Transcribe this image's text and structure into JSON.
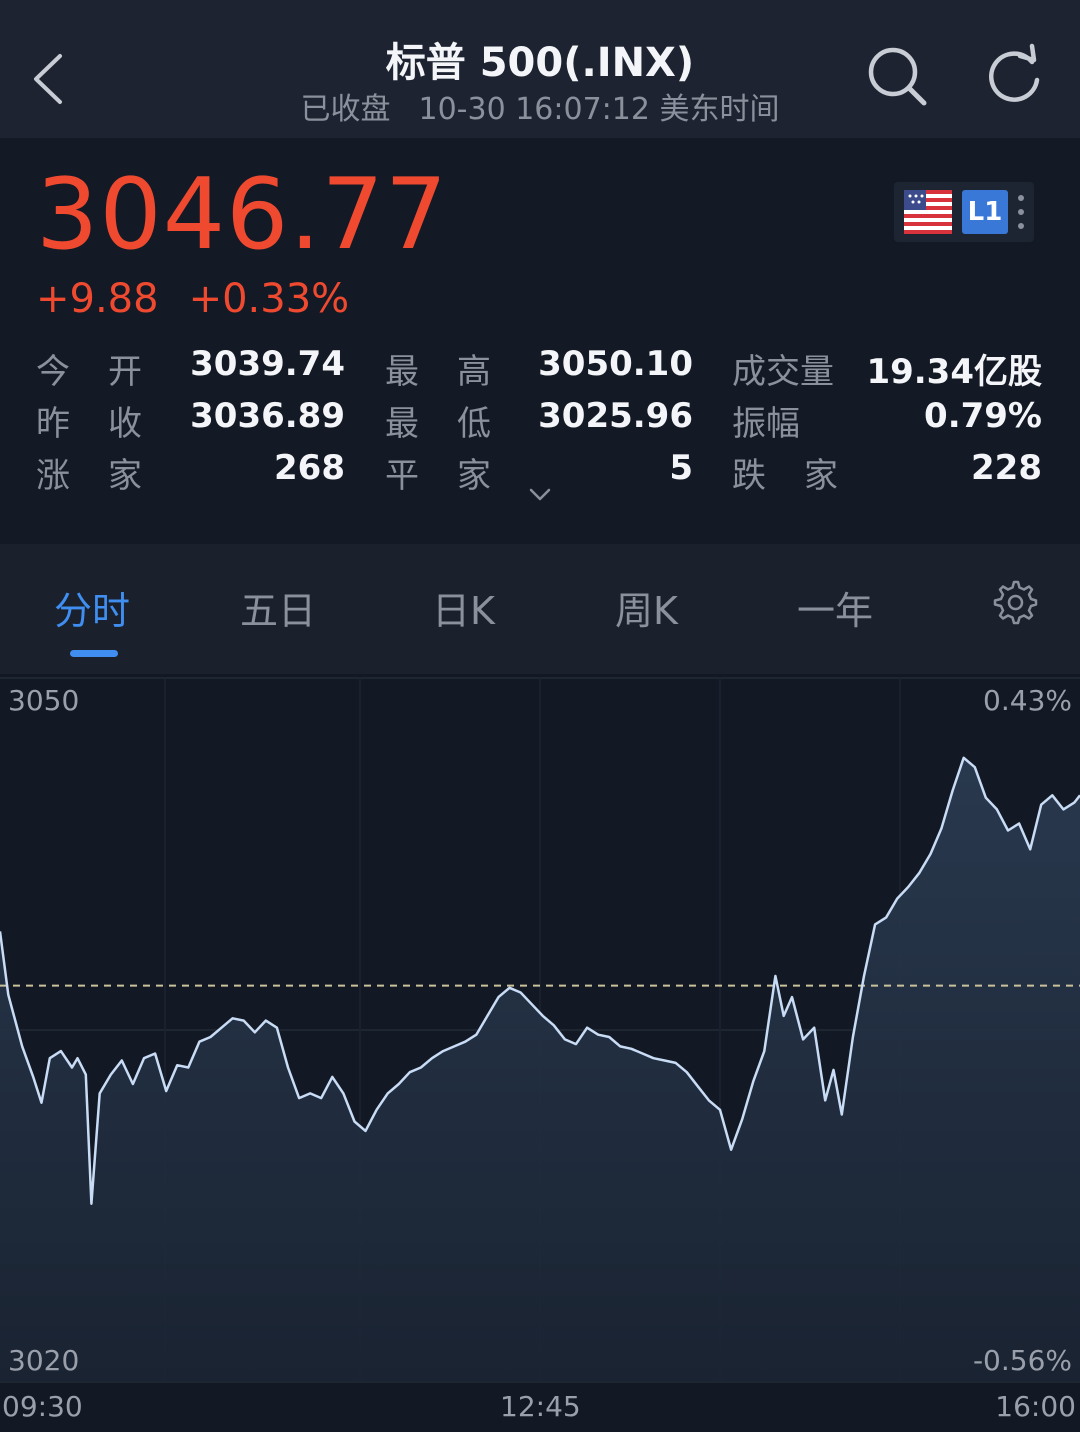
{
  "header": {
    "title": "标普 500(.INX)",
    "status": "已收盘",
    "timestamp": "10-30 16:07:12 美东时间",
    "icons": [
      "chevron-left-icon",
      "search-icon",
      "refresh-icon"
    ]
  },
  "quote": {
    "price": "3046.77",
    "change": "+9.88",
    "change_pct": "+0.33%",
    "level_badge": "L1",
    "colors": {
      "up": "#ef4a30",
      "accent": "#3f8ef0"
    }
  },
  "stats": {
    "open_label": "今开",
    "open_value": "3039.74",
    "high_label": "最高",
    "high_value": "3050.10",
    "volume_label": "成交量",
    "volume_value": "19.34亿股",
    "prev_close_label": "昨收",
    "prev_close_value": "3036.89",
    "low_label": "最低",
    "low_value": "3025.96",
    "amplitude_label": "振幅",
    "amplitude_value": "0.79%",
    "advancers_label": "涨家",
    "advancers_value": "268",
    "unchanged_label": "平家",
    "unchanged_value": "5",
    "decliners_label": "跌家",
    "decliners_value": "228"
  },
  "tabs": [
    {
      "label": "分时",
      "active": true
    },
    {
      "label": "五日",
      "active": false
    },
    {
      "label": "日K",
      "active": false
    },
    {
      "label": "周K",
      "active": false
    },
    {
      "label": "一年",
      "active": false
    }
  ],
  "chart_data": {
    "type": "area",
    "y_labels": {
      "top_left": "3050",
      "bottom_left": "3020",
      "top_right": "0.43%",
      "bottom_right": "-0.56%"
    },
    "x_labels": [
      "09:30",
      "12:45",
      "16:00"
    ],
    "ylim": [
      3020,
      3050
    ],
    "baseline": 3036.89,
    "grid": true,
    "line_color": "#c9dcf5",
    "points": [
      [
        0,
        3039.2
      ],
      [
        3,
        3036.5
      ],
      [
        8,
        3034.3
      ],
      [
        12,
        3033.0
      ],
      [
        15,
        3031.9
      ],
      [
        18,
        3033.8
      ],
      [
        22,
        3034.1
      ],
      [
        26,
        3033.4
      ],
      [
        28,
        3033.8
      ],
      [
        31,
        3033.1
      ],
      [
        33,
        3027.6
      ],
      [
        36,
        3032.3
      ],
      [
        40,
        3033.1
      ],
      [
        44,
        3033.7
      ],
      [
        48,
        3032.7
      ],
      [
        52,
        3033.8
      ],
      [
        56,
        3034.0
      ],
      [
        60,
        3032.4
      ],
      [
        64,
        3033.5
      ],
      [
        68,
        3033.4
      ],
      [
        72,
        3034.5
      ],
      [
        76,
        3034.7
      ],
      [
        80,
        3035.1
      ],
      [
        84,
        3035.5
      ],
      [
        88,
        3035.4
      ],
      [
        92,
        3034.9
      ],
      [
        96,
        3035.4
      ],
      [
        100,
        3035.1
      ],
      [
        104,
        3033.4
      ],
      [
        108,
        3032.1
      ],
      [
        112,
        3032.3
      ],
      [
        116,
        3032.1
      ],
      [
        120,
        3033.0
      ],
      [
        124,
        3032.3
      ],
      [
        128,
        3031.1
      ],
      [
        132,
        3030.7
      ],
      [
        136,
        3031.6
      ],
      [
        140,
        3032.3
      ],
      [
        144,
        3032.7
      ],
      [
        148,
        3033.2
      ],
      [
        152,
        3033.4
      ],
      [
        156,
        3033.8
      ],
      [
        160,
        3034.1
      ],
      [
        164,
        3034.3
      ],
      [
        168,
        3034.5
      ],
      [
        172,
        3034.8
      ],
      [
        176,
        3035.6
      ],
      [
        180,
        3036.4
      ],
      [
        184,
        3036.8
      ],
      [
        188,
        3036.6
      ],
      [
        192,
        3036.1
      ],
      [
        196,
        3035.6
      ],
      [
        200,
        3035.2
      ],
      [
        204,
        3034.6
      ],
      [
        208,
        3034.4
      ],
      [
        212,
        3035.1
      ],
      [
        216,
        3034.8
      ],
      [
        220,
        3034.7
      ],
      [
        224,
        3034.3
      ],
      [
        228,
        3034.2
      ],
      [
        232,
        3034.0
      ],
      [
        236,
        3033.8
      ],
      [
        240,
        3033.7
      ],
      [
        244,
        3033.6
      ],
      [
        248,
        3033.2
      ],
      [
        252,
        3032.6
      ],
      [
        256,
        3032.0
      ],
      [
        260,
        3031.6
      ],
      [
        264,
        3029.9
      ],
      [
        268,
        3031.2
      ],
      [
        272,
        3032.8
      ],
      [
        276,
        3034.1
      ],
      [
        280,
        3037.3
      ],
      [
        283,
        3035.6
      ],
      [
        286,
        3036.4
      ],
      [
        290,
        3034.6
      ],
      [
        294,
        3035.1
      ],
      [
        298,
        3032.0
      ],
      [
        301,
        3033.3
      ],
      [
        304,
        3031.4
      ],
      [
        308,
        3034.7
      ],
      [
        312,
        3037.3
      ],
      [
        316,
        3039.5
      ],
      [
        320,
        3039.8
      ],
      [
        324,
        3040.6
      ],
      [
        328,
        3041.1
      ],
      [
        332,
        3041.7
      ],
      [
        336,
        3042.5
      ],
      [
        340,
        3043.6
      ],
      [
        344,
        3045.2
      ],
      [
        348,
        3046.6
      ],
      [
        352,
        3046.2
      ],
      [
        356,
        3044.9
      ],
      [
        360,
        3044.4
      ],
      [
        364,
        3043.5
      ],
      [
        368,
        3043.8
      ],
      [
        372,
        3042.7
      ],
      [
        376,
        3044.6
      ],
      [
        380,
        3045.0
      ],
      [
        384,
        3044.4
      ],
      [
        388,
        3044.7
      ],
      [
        390,
        3045.0
      ]
    ]
  }
}
